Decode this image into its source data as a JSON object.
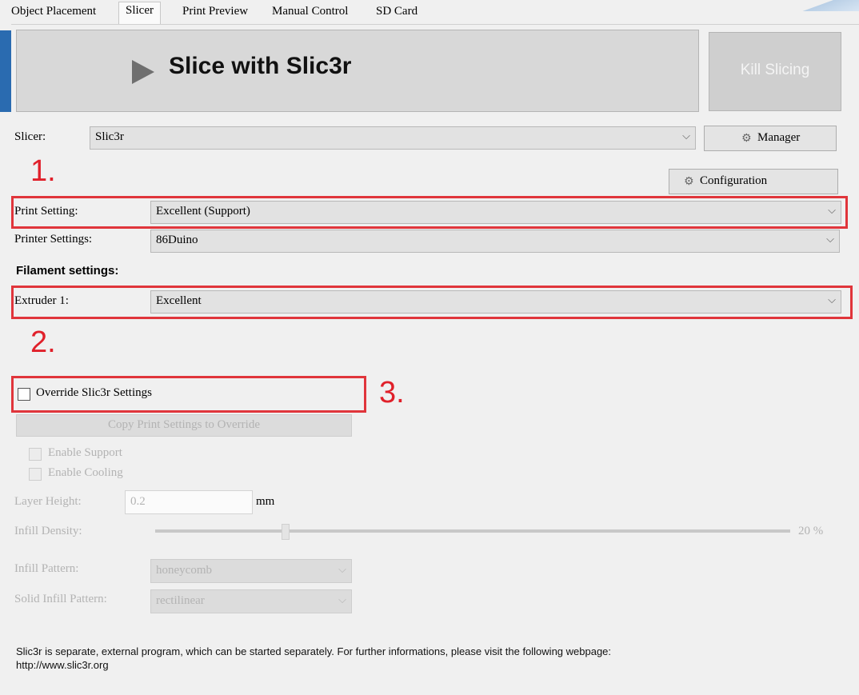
{
  "tabs": [
    "Object Placement",
    "Slicer",
    "Print Preview",
    "Manual Control",
    "SD Card"
  ],
  "slice_button": {
    "label": "Slice with Slic3r",
    "icon": "play-icon"
  },
  "kill_button": {
    "label": "Kill Slicing"
  },
  "slicer": {
    "label": "Slicer:",
    "value": "Slic3r"
  },
  "manager_button": {
    "label": "Manager",
    "icon": "gears-icon"
  },
  "configuration_button": {
    "label": "Configuration",
    "icon": "gear-icon"
  },
  "markers": [
    "1.",
    "2.",
    "3."
  ],
  "print_setting": {
    "label": "Print Setting:",
    "value": "Excellent (Support)"
  },
  "printer_settings": {
    "label": "Printer Settings:",
    "value": "86Duino"
  },
  "filament": {
    "heading": "Filament settings:",
    "extruder_label": "Extruder 1:",
    "extruder_value": "Excellent"
  },
  "override": {
    "label": "Override Slic3r Settings",
    "checked": false
  },
  "copy_button": {
    "label": "Copy Print Settings to Override"
  },
  "enable_support": {
    "label": "Enable Support"
  },
  "enable_cooling": {
    "label": "Enable Cooling"
  },
  "layer_height": {
    "label": "Layer Height:",
    "value": "0.2",
    "unit": "mm"
  },
  "infill_density": {
    "label": "Infill Density:",
    "value_text": "20 %",
    "value": 20
  },
  "infill_pattern": {
    "label": "Infill Pattern:",
    "value": "honeycomb"
  },
  "solid_infill_pattern": {
    "label": "Solid Infill Pattern:",
    "value": "rectilinear"
  },
  "info": {
    "line1": "Slic3r is separate, external program, which can be started separately. For further informations, please visit the following webpage:",
    "line2": "http://www.slic3r.org"
  },
  "colors": {
    "highlight": "#e0353b",
    "marker": "#e0202a",
    "accent": "#2a6bb0"
  }
}
